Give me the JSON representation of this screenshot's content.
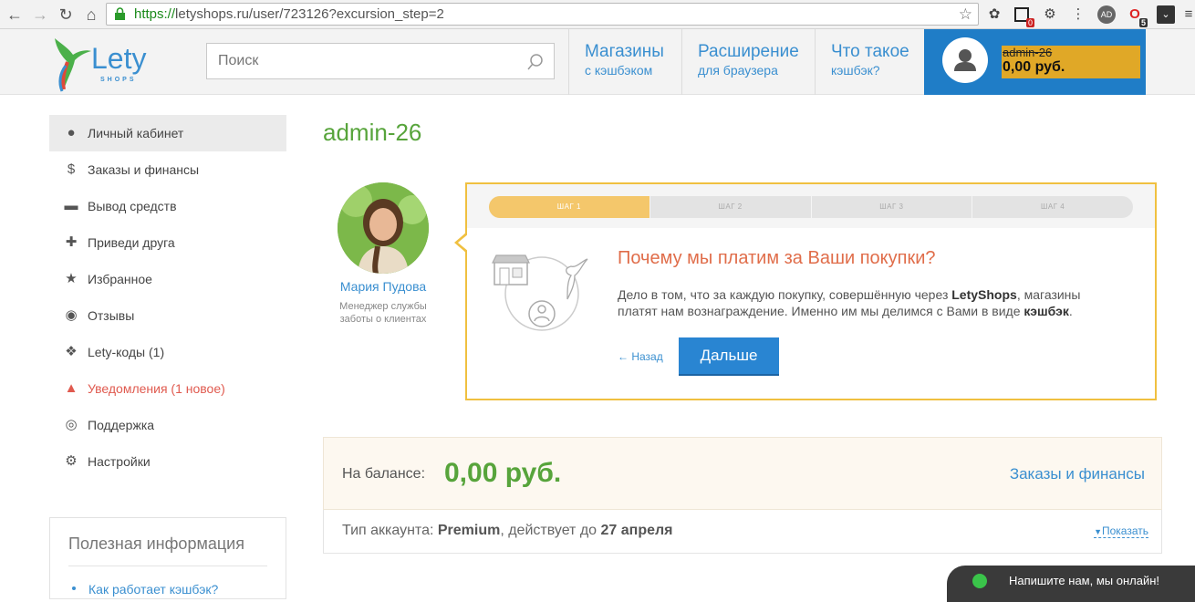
{
  "browser": {
    "url_scheme": "https://",
    "url_rest": "letyshops.ru/user/723126?excursion_step=2",
    "ext_badges": [
      "0",
      "5"
    ]
  },
  "header": {
    "logo_main": "Lety",
    "logo_sub": "SHOPS",
    "search_placeholder": "Поиск",
    "nav": [
      {
        "title": "Магазины",
        "sub": "с кэшбэком"
      },
      {
        "title": "Расширение",
        "sub": "для браузера"
      },
      {
        "title": "Что такое",
        "sub": "кэшбэк?"
      }
    ],
    "account": {
      "username": "admin-26",
      "balance": "0,00 руб."
    }
  },
  "sidebar": {
    "items": [
      {
        "label": "Личный кабинет",
        "icon": "user-icon"
      },
      {
        "label": "Заказы и финансы",
        "icon": "dollar-icon"
      },
      {
        "label": "Вывод средств",
        "icon": "credit-card-icon"
      },
      {
        "label": "Приведи друга",
        "icon": "add-user-icon"
      },
      {
        "label": "Избранное",
        "icon": "star-icon"
      },
      {
        "label": "Отзывы",
        "icon": "comments-icon"
      },
      {
        "label": "Lety-коды (1)",
        "icon": "tags-icon"
      },
      {
        "label": "Уведомления (1 новое)",
        "icon": "bell-icon"
      },
      {
        "label": "Поддержка",
        "icon": "lifebuoy-icon"
      },
      {
        "label": "Настройки",
        "icon": "gear-icon"
      }
    ],
    "useful_title": "Полезная информация",
    "useful_link": "Как работает кэшбэк?"
  },
  "main": {
    "title": "admin-26",
    "manager": {
      "name": "Мария Пудова",
      "role": "Менеджер службы заботы о клиентах"
    },
    "excursion": {
      "steps": [
        "ШАГ 1",
        "ШАГ 2",
        "ШАГ 3",
        "ШАГ 4"
      ],
      "heading": "Почему мы платим за Ваши покупки?",
      "desc_1": "Дело в том, что за каждую покупку, совершённую через ",
      "desc_brand": "LetyShops",
      "desc_2": ", магазины платят нам вознаграждение. Именно им мы делимся с Вами в виде ",
      "desc_term": "кэшбэк",
      "desc_end": ".",
      "back_label": "← Назад",
      "next_label": "Дальше"
    },
    "balance": {
      "label": "На балансе:",
      "value": "0,00 руб.",
      "link": "Заказы и финансы"
    },
    "account_type": {
      "prefix": "Тип аккаунта: ",
      "type": "Premium",
      "middle": ", действует до ",
      "date": "27 апреля",
      "show_label": "Показать"
    }
  },
  "chat": {
    "label": "Напишите нам, мы онлайн!"
  },
  "colors": {
    "accent_blue": "#3a8fd0",
    "green": "#57a43b",
    "orange_heading": "#e06d4a",
    "alert_red": "#e05a4f",
    "step_active": "#f4c76b"
  }
}
